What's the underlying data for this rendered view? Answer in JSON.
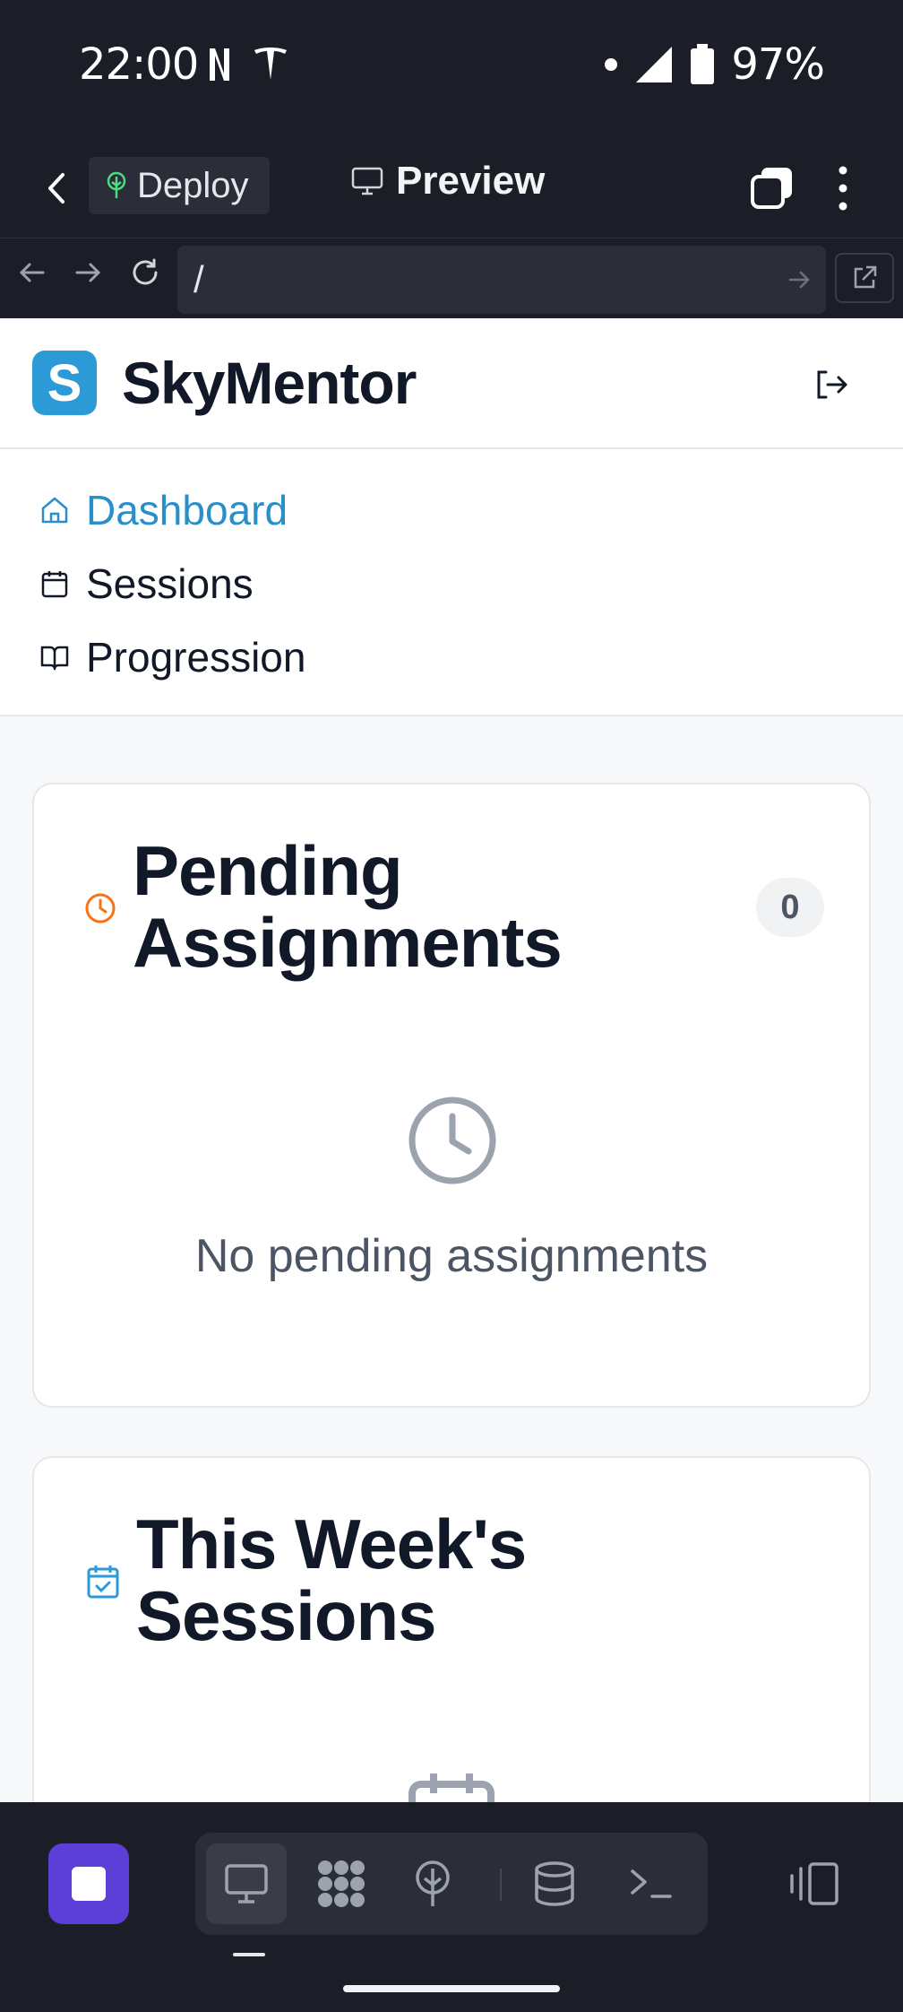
{
  "status_bar": {
    "time": "22:00",
    "battery": "97%"
  },
  "toolbar": {
    "deploy_label": "Deploy",
    "preview_label": "Preview"
  },
  "url_bar": {
    "value": "/"
  },
  "app": {
    "name": "SkyMentor",
    "logo_letter": "S"
  },
  "nav": {
    "items": [
      {
        "label": "Dashboard",
        "icon": "home-icon",
        "active": true
      },
      {
        "label": "Sessions",
        "icon": "calendar-icon",
        "active": false
      },
      {
        "label": "Progression",
        "icon": "book-icon",
        "active": false
      }
    ]
  },
  "cards": {
    "pending": {
      "title_line1": "Pending",
      "title_line2": "Assignments",
      "count": "0",
      "empty_message": "No pending assignments",
      "icon": "clock-icon",
      "icon_color": "#f97316"
    },
    "week": {
      "title_line1": "This Week's",
      "title_line2": "Sessions",
      "icon": "calendar-check-icon",
      "icon_color": "#2b9ad6"
    }
  },
  "colors": {
    "accent": "#2b9ad6",
    "stop_button": "#5b3fd6",
    "dark_chrome": "#1c1e27"
  }
}
